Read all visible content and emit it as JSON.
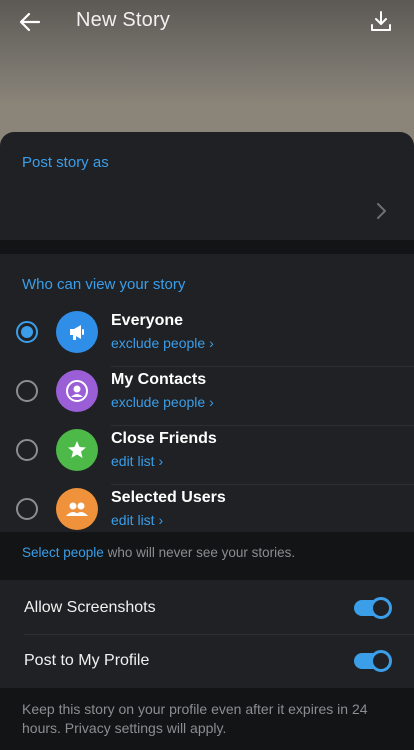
{
  "header": {
    "title": "New Story",
    "back_icon": "arrow-left-icon",
    "download_icon": "download-icon"
  },
  "post_as": {
    "heading": "Post story as"
  },
  "audience": {
    "heading": "Who can view your story",
    "selected": "Everyone",
    "options": [
      {
        "title": "Everyone",
        "sub": "exclude people",
        "icon": "megaphone-icon",
        "color": "#2f8fe8"
      },
      {
        "title": "My Contacts",
        "sub": "exclude people",
        "icon": "person-icon",
        "color": "#9a5fd6"
      },
      {
        "title": "Close Friends",
        "sub": "edit list",
        "icon": "star-icon",
        "color": "#4cb948"
      },
      {
        "title": "Selected Users",
        "sub": "edit list",
        "icon": "group-icon",
        "color": "#f0913c"
      }
    ]
  },
  "note": {
    "link": "Select people",
    "rest": " who will never see your stories."
  },
  "settings": {
    "allow_screenshots": {
      "label": "Allow Screenshots",
      "on": true
    },
    "post_to_profile": {
      "label": "Post to My Profile",
      "on": true
    }
  },
  "footer": {
    "text": "Keep this story on your profile even after it expires in 24 hours. Privacy settings will apply."
  },
  "colors": {
    "accent": "#3a9ee9",
    "sheet": "#202124",
    "band": "#131415"
  }
}
